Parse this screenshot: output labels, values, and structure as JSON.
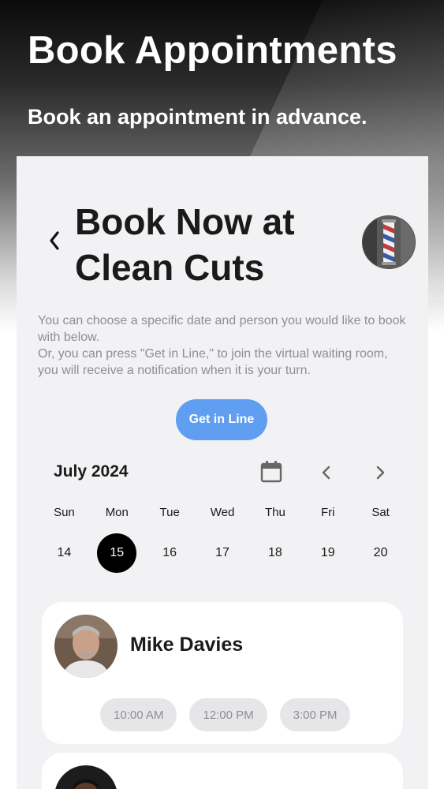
{
  "hero": {
    "title": "Book Appointments",
    "subtitle": "Book an appointment in advance."
  },
  "header": {
    "back_icon": "chevron-left-icon",
    "title_line1": "Book Now at",
    "title_line2": "Clean Cuts"
  },
  "intro": {
    "line1": "You can choose a specific date and person you would like to book with below.",
    "line2": "Or, you can press \"Get in Line,\" to join the virtual waiting room, you will receive a notification when it is your turn."
  },
  "get_in_line_label": "Get in Line",
  "calendar": {
    "month_label": "July 2024",
    "weekdays": [
      "Sun",
      "Mon",
      "Tue",
      "Wed",
      "Thu",
      "Fri",
      "Sat"
    ],
    "days": [
      "14",
      "15",
      "16",
      "17",
      "18",
      "19",
      "20"
    ],
    "selected_day": "15"
  },
  "barbers": [
    {
      "name": "Mike Davies",
      "slots": [
        "10:00 AM",
        "12:00 PM",
        "3:00 PM"
      ]
    }
  ],
  "colors": {
    "accent": "#5f9ef0",
    "selected_day_bg": "#000000",
    "panel_bg": "#f2f2f4"
  }
}
